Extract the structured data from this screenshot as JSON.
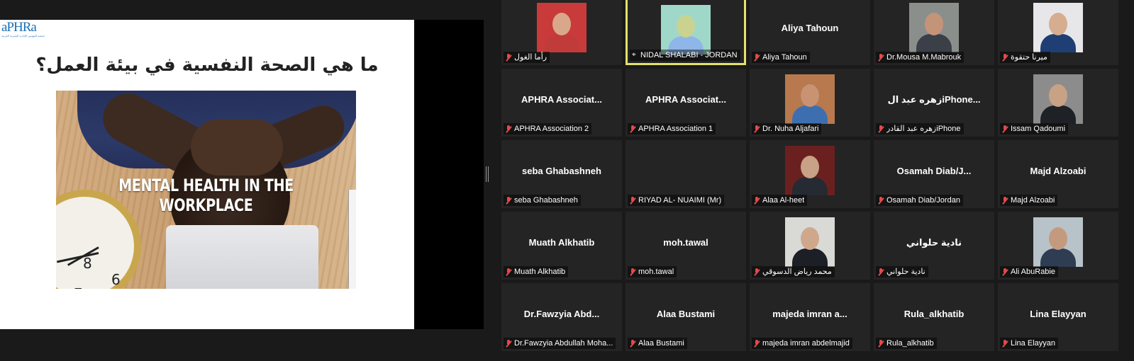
{
  "slide": {
    "logo_text": "aPHRa",
    "logo_subtext": "جمعية المهنيين للإدارة البشرية العربية",
    "title": "ما هي الصحة النفسية في بيئة العمل؟",
    "image_caption": "MENTAL HEALTH IN THE WORKPLACE"
  },
  "raised_hand_icon": "✋",
  "participants": [
    {
      "name": "رأما الغول",
      "display": "",
      "video": true,
      "avatar_bg": "#c93a3a",
      "face": "#d9a78a",
      "body": "#c23b3b"
    },
    {
      "name": "NIDAL SHALABI - JORDAN",
      "display": "",
      "video": true,
      "active": true,
      "pinned": true,
      "avatar_bg": "#9fd8c9",
      "face": "#c9d38f",
      "body": "#8fb6e8"
    },
    {
      "name": "Aliya Tahoun",
      "display": "Aliya Tahoun",
      "video": false
    },
    {
      "name": "Dr.Mousa M.Mabrouk",
      "display": "",
      "video": true,
      "avatar_bg": "#8a8f8c",
      "face": "#c49479",
      "body": "#3a3f48"
    },
    {
      "name": "ميرنا حتقوة",
      "display": "",
      "video": true,
      "avatar_bg": "#e7e7ea",
      "face": "#d6ad8f",
      "body": "#1f3e74"
    },
    {
      "name": "APHRA Association 2",
      "display": "APHRA Associat...",
      "video": false
    },
    {
      "name": "APHRA Association 1",
      "display": "APHRA Associat...",
      "video": false
    },
    {
      "name": "Dr. Nuha Aljafari",
      "display": "",
      "video": true,
      "avatar_bg": "#b7794d",
      "face": "#c89273",
      "body": "#3d6fb0"
    },
    {
      "name": "زهره عبد القادرiPhone",
      "display": "زهره عبد الiPhone...",
      "video": false
    },
    {
      "name": "Issam Qadoumi",
      "display": "",
      "video": true,
      "avatar_bg": "#8c8c8c",
      "face": "#c8a285",
      "body": "#1e2125"
    },
    {
      "name": "seba Ghabashneh",
      "display": "seba Ghabashneh",
      "video": false
    },
    {
      "name": "RIYAD AL- NUAIMI (Mr)",
      "display": "",
      "video": false
    },
    {
      "name": "Alaa Al-heet",
      "display": "",
      "video": true,
      "avatar_bg": "#6b2020",
      "face": "#c9a186",
      "body": "#252a33"
    },
    {
      "name": "Osamah Diab/Jordan",
      "display": "Osamah  Diab/J...",
      "video": false
    },
    {
      "name": "Majd Alzoabi",
      "display": "Majd Alzoabi",
      "video": false
    },
    {
      "name": "Muath Alkhatib",
      "display": "Muath Alkhatib",
      "video": false
    },
    {
      "name": "moh.tawal",
      "display": "moh.tawal",
      "video": false
    },
    {
      "name": "محمد رياض الدسوقي",
      "display": "",
      "video": true,
      "avatar_bg": "#d9d9d6",
      "face": "#cfa88c",
      "body": "#1c1f25"
    },
    {
      "name": "نادية حلواني",
      "display": "نادية حلواني",
      "video": false
    },
    {
      "name": "Ali AbuRabie",
      "display": "",
      "video": true,
      "avatar_bg": "#b7c3c9",
      "face": "#c49a7f",
      "body": "#2e3d52"
    },
    {
      "name": "Dr.Fawzyia Abdullah Moha...",
      "display": "Dr.Fawzyia  Abd...",
      "video": false
    },
    {
      "name": "Alaa Bustami",
      "display": "Alaa Bustami",
      "video": false
    },
    {
      "name": "majeda imran abdelmajid",
      "display": "majeda  imran  a...",
      "video": false
    },
    {
      "name": "Rula_alkhatib",
      "display": "Rula_alkhatib",
      "video": false
    },
    {
      "name": "Lina Elayyan",
      "display": "Lina Elayyan",
      "video": false
    }
  ]
}
